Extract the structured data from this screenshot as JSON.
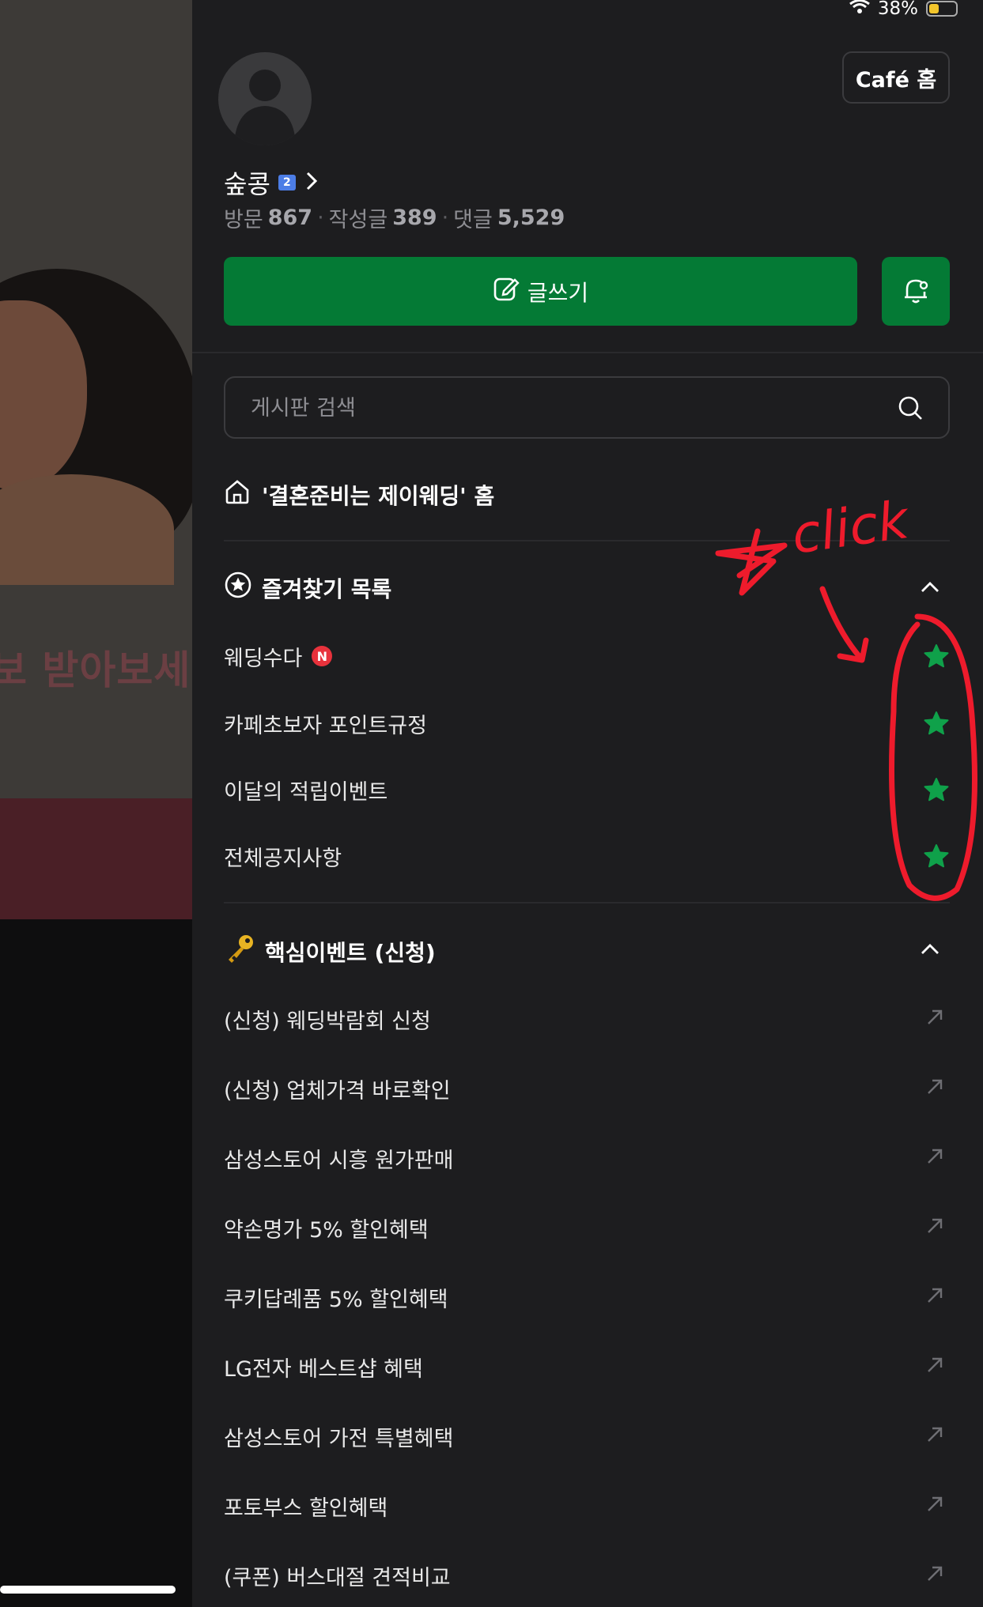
{
  "status_bar": {
    "battery_percent_text": "38%",
    "battery_level": 0.38
  },
  "profile": {
    "nickname": "숲콩",
    "level_badge": "2",
    "stats": [
      {
        "label": "방문",
        "value": "867"
      },
      {
        "label": "작성글",
        "value": "389"
      },
      {
        "label": "댓글",
        "value": "5,529"
      }
    ]
  },
  "header": {
    "cafe_home_label": "Café 홈"
  },
  "actions": {
    "write_label": "글쓰기"
  },
  "search": {
    "placeholder": "게시판 검색"
  },
  "cafe_home_link": {
    "label": "'결혼준비는 제이웨딩' 홈"
  },
  "favorites": {
    "title": "즐겨찾기 목록",
    "items": [
      {
        "label": "웨딩수다",
        "badge": "N"
      },
      {
        "label": "카페초보자 포인트규정"
      },
      {
        "label": "이달의 적립이벤트"
      },
      {
        "label": "전체공지사항"
      }
    ]
  },
  "core_events": {
    "title": "핵심이벤트 (신청)",
    "items": [
      {
        "label": "(신청) 웨딩박람회 신청"
      },
      {
        "label": "(신청) 업체가격 바로확인"
      },
      {
        "label": "삼성스토어 시흥 원가판매"
      },
      {
        "label": "약손명가 5% 할인혜택"
      },
      {
        "label": "쿠키답례품 5% 할인혜택"
      },
      {
        "label": "LG전자 베스트샵 혜택"
      },
      {
        "label": "삼성스토어 가전 특별혜택"
      },
      {
        "label": "포토부스 할인혜택"
      },
      {
        "label": "(쿠폰) 버스대절 견적비교"
      }
    ]
  },
  "background_page": {
    "banner_text": "보 받아보세"
  },
  "annotation": {
    "text": "click"
  },
  "colors": {
    "accent_green": "#047a35",
    "star_green": "#0fa14a",
    "annotation_red": "#ee1b2c",
    "new_badge_red": "#e8323c"
  }
}
